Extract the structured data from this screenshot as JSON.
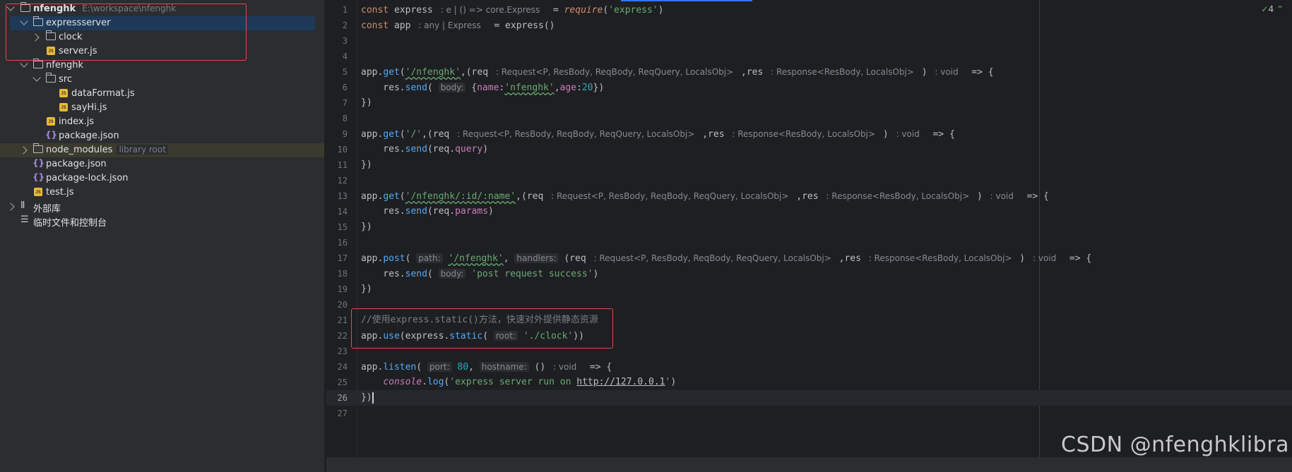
{
  "project_tree": {
    "root": {
      "name": "nfenghk",
      "path": "E:\\workspace\\nfenghk"
    },
    "items": [
      {
        "label": "expressserver",
        "type": "folder"
      },
      {
        "label": "clock",
        "type": "folder"
      },
      {
        "label": "server.js",
        "type": "js"
      },
      {
        "label": "nfenghk",
        "type": "folder"
      },
      {
        "label": "src",
        "type": "folder"
      },
      {
        "label": "dataFormat.js",
        "type": "js"
      },
      {
        "label": "sayHi.js",
        "type": "js"
      },
      {
        "label": "index.js",
        "type": "js"
      },
      {
        "label": "package.json",
        "type": "json"
      },
      {
        "label": "node_modules",
        "hint": "library root",
        "type": "folder"
      },
      {
        "label": "package.json",
        "type": "json"
      },
      {
        "label": "package-lock.json",
        "type": "json"
      },
      {
        "label": "test.js",
        "type": "js"
      },
      {
        "label": "外部库",
        "type": "library"
      },
      {
        "label": "临时文件和控制台",
        "type": "scratch"
      }
    ]
  },
  "editor": {
    "inspection_count": "4",
    "line_numbers": [
      "1",
      "2",
      "3",
      "4",
      "5",
      "6",
      "7",
      "8",
      "9",
      "10",
      "11",
      "12",
      "13",
      "14",
      "15",
      "16",
      "17",
      "18",
      "19",
      "20",
      "21",
      "22",
      "23",
      "24",
      "25",
      "26",
      "27"
    ],
    "current_line": "26",
    "hints": {
      "express_type": ": e | () => core.Express",
      "app_type": ": any | Express",
      "req_type": ": Request<P, ResBody, ReqBody, ReqQuery, LocalsObj>",
      "res_type": ": Response<ResBody, LocalsObj>",
      "void_type": ": void",
      "body": "body:",
      "path": "path:",
      "handlers": "handlers:",
      "root": "root:",
      "port": "port:",
      "hostname": "hostname:"
    },
    "strings": {
      "express_module": "'express'",
      "route_nfenghk": "'/nfenghk'",
      "name_value": "'nfenghk'",
      "route_root": "'/'",
      "route_params": "'/nfenghk/:id/:name'",
      "post_success": "'post request success'",
      "static_dir": "'./clock'",
      "log_prefix": "'express server run on ",
      "log_url": "http://127.0.0.1",
      "log_suffix": "'"
    },
    "numbers": {
      "age": "20",
      "port": "80"
    },
    "comment": "//使用express.static()方法，快速对外提供静态资源"
  },
  "watermark": "CSDN @nfenghklibra"
}
